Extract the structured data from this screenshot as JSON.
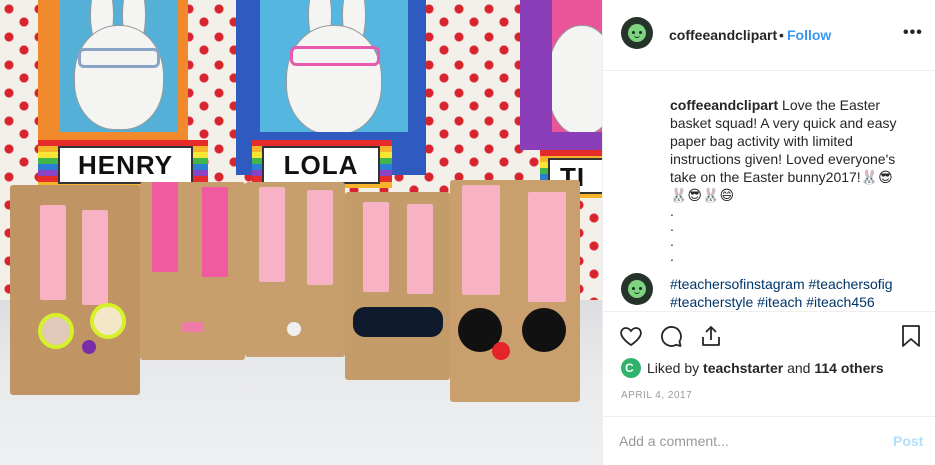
{
  "post": {
    "image_alt_subject": "easter bunny paper bags",
    "nametags": [
      "HENRY",
      "LOLA",
      "TI"
    ]
  },
  "header": {
    "username": "coffeeandclipart",
    "separator": "•",
    "follow_label": "Follow",
    "more_icon": "more-horizontal-icon"
  },
  "caption": {
    "username": "coffeeandclipart",
    "text": "Love the Easter basket squad! A very quick and easy paper bag activity with limited instructions given! Loved everyone's take on the Easter bunny2017!🐰😎 🐰😎🐰😄",
    "dots": [
      ".",
      ".",
      ".",
      "."
    ]
  },
  "hashtags": "#teachersofinstagram #teachersofig #teacherstyle #iteach #iteach456",
  "actions": {
    "like_icon": "heart-icon",
    "comment_icon": "comment-icon",
    "share_icon": "share-icon",
    "save_icon": "bookmark-icon"
  },
  "likes": {
    "prefix": "Liked by ",
    "user": "teachstarter",
    "middle": " and ",
    "others": "114 others"
  },
  "date": "APRIL 4, 2017",
  "comment_box": {
    "placeholder": "Add a comment...",
    "post_label": "Post"
  },
  "colors": {
    "follow": "#3897f0",
    "hashtag": "#003569",
    "post_disabled": "#b2dffc"
  }
}
